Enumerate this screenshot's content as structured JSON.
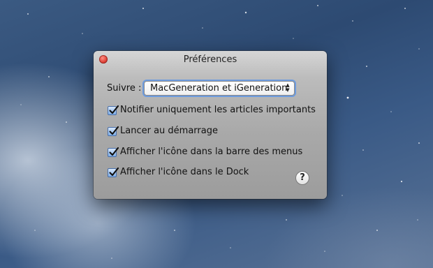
{
  "window": {
    "title": "Préférences"
  },
  "follow": {
    "label": "Suivre :",
    "selected": "MacGeneration et iGeneration"
  },
  "options": [
    {
      "label": "Notifier uniquement les articles importants",
      "checked": true
    },
    {
      "label": "Lancer au démarrage",
      "checked": true
    },
    {
      "label": "Afficher l'icône dans la barre des menus",
      "checked": true
    },
    {
      "label": "Afficher l'icône dans le Dock",
      "checked": true
    }
  ],
  "help": {
    "label": "?"
  }
}
